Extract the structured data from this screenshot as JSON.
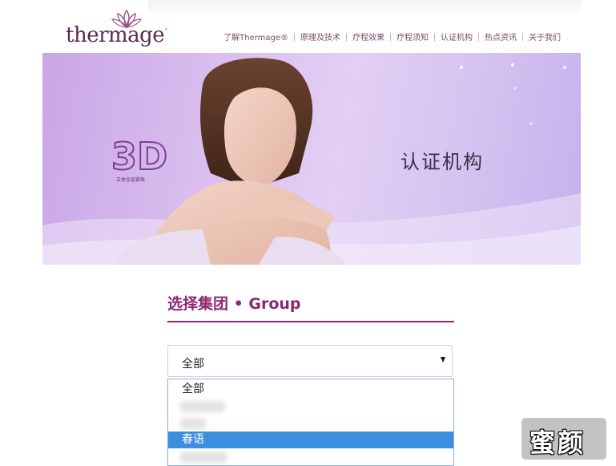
{
  "header": {
    "logo_text": "thermage",
    "logo_mark": "·",
    "nav": [
      {
        "label": "了解Thermage®"
      },
      {
        "label": "原理及技术"
      },
      {
        "label": "疗程效果"
      },
      {
        "label": "疗程须知"
      },
      {
        "label": "认证机构"
      },
      {
        "label": "热点资讯"
      },
      {
        "label": "关于我们"
      }
    ]
  },
  "banner": {
    "title": "认证机构",
    "badge_main": "3D",
    "badge_sub": "立体全层紧致"
  },
  "content": {
    "section_title": "选择集团 • Group",
    "select": {
      "value": "全部",
      "options": [
        {
          "label": "全部",
          "selected": false
        },
        {
          "label": "",
          "selected": false
        },
        {
          "label": "",
          "selected": false
        },
        {
          "label": "春语",
          "selected": true
        },
        {
          "label": "",
          "selected": false
        }
      ]
    }
  },
  "watermark": {
    "text": "蜜颜"
  },
  "colors": {
    "brand": "#8b2a73",
    "logo": "#5c2a4e",
    "selected_option": "#3b8fe0",
    "banner": "#d9c2f0"
  }
}
